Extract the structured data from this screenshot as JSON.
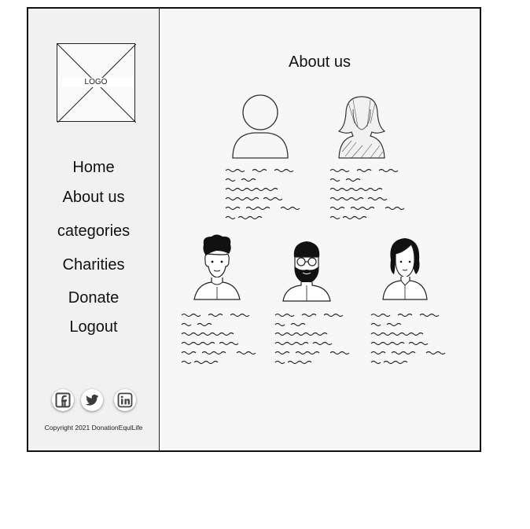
{
  "logo": {
    "label": "LOGO"
  },
  "nav": {
    "home": "Home",
    "about": "About us",
    "categories": "categories",
    "charities": "Charities",
    "donate": "Donate",
    "logout": "Logout"
  },
  "social": {
    "facebook": "facebook-icon",
    "twitter": "twitter-icon",
    "linkedin": "linkedin-icon"
  },
  "footer": {
    "copyright": "Copyright 2021 DonationEqulLife"
  },
  "main": {
    "title": "About us"
  },
  "team": [
    {
      "avatar": "generic-male-avatar-icon"
    },
    {
      "avatar": "generic-female-avatar-icon"
    },
    {
      "avatar": "man-curly-hair-avatar-icon"
    },
    {
      "avatar": "bearded-man-glasses-avatar-icon"
    },
    {
      "avatar": "woman-bob-hair-avatar-icon"
    }
  ]
}
